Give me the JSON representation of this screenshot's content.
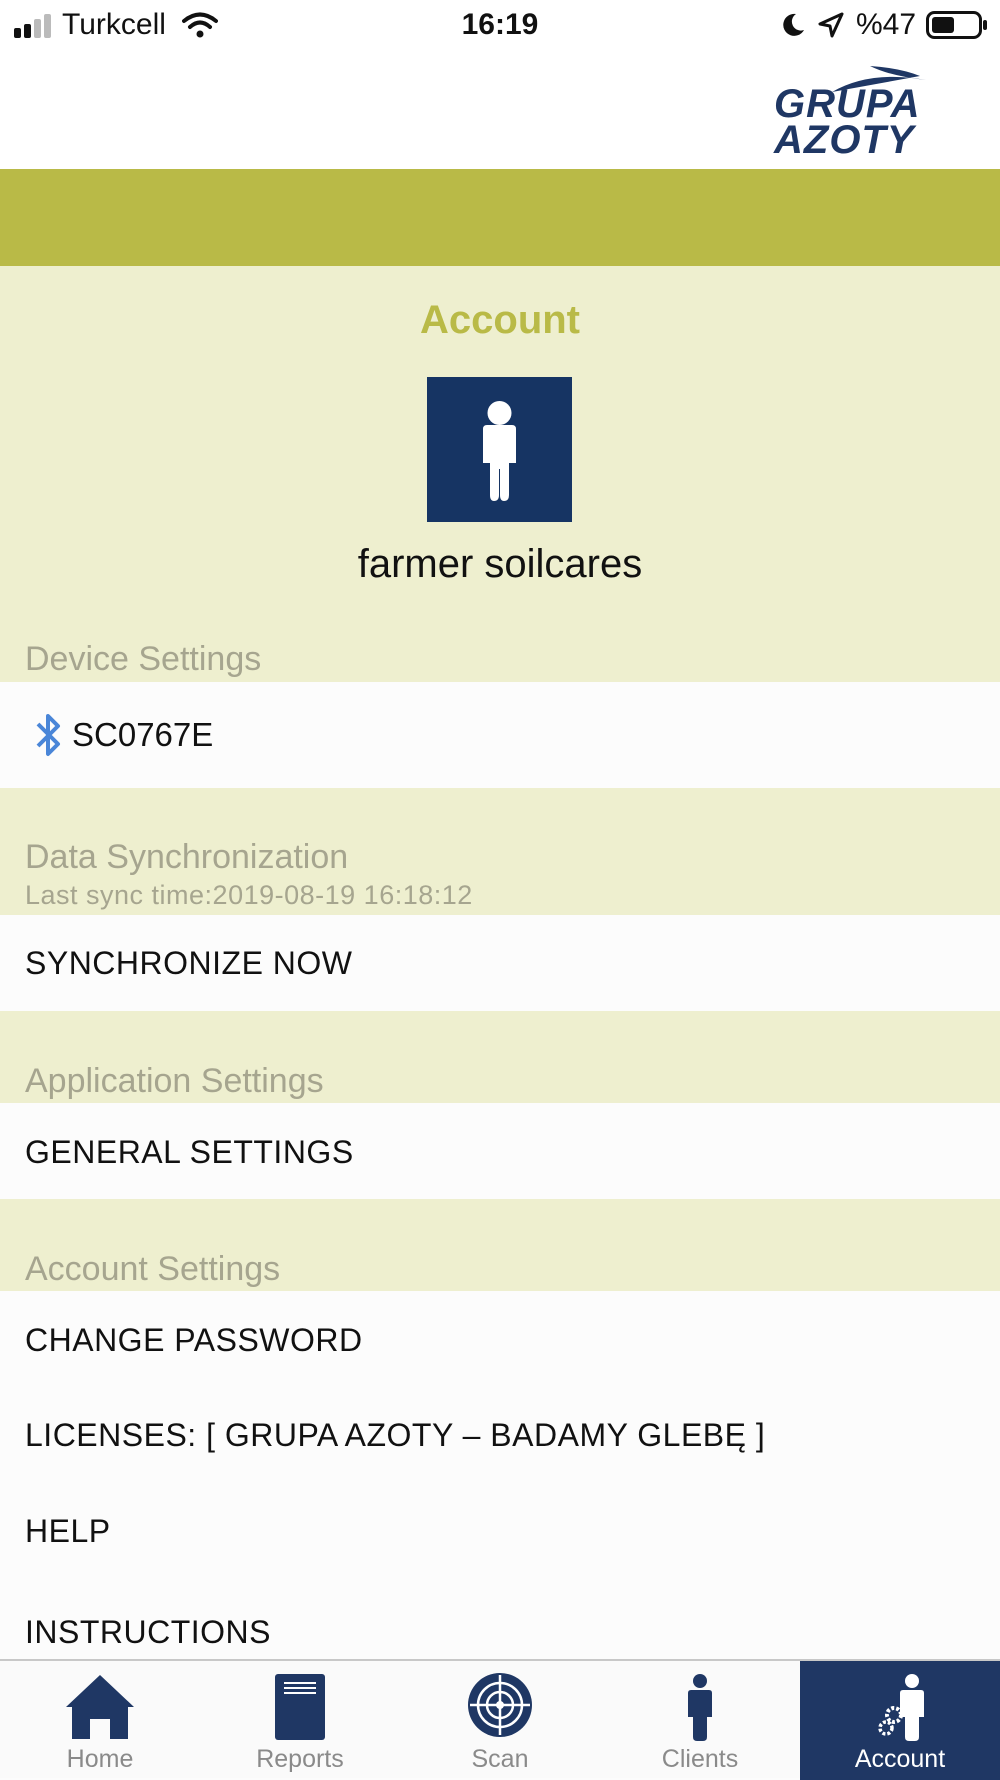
{
  "status_bar": {
    "carrier": "Turkcell",
    "time": "16:19",
    "battery": "%47"
  },
  "header": {
    "logo_line1": "GRUPA",
    "logo_line2": "AZOTY"
  },
  "account": {
    "title": "Account",
    "user_name": "farmer soilcares"
  },
  "device_settings": {
    "title": "Device Settings",
    "device_name": "SC0767E"
  },
  "data_sync": {
    "title": "Data Synchronization",
    "last_sync": "Last sync time:2019-08-19 16:18:12",
    "sync_now": "SYNCHRONIZE NOW"
  },
  "application_settings": {
    "title": "Application Settings",
    "general": "GENERAL SETTINGS"
  },
  "account_settings": {
    "title": "Account Settings",
    "change_password": "CHANGE PASSWORD",
    "licenses": "LICENSES: [ GRUPA AZOTY – BADAMY GLEBĘ ]",
    "help": "HELP",
    "instructions": "INSTRUCTIONS"
  },
  "nav": {
    "items": [
      {
        "label": "Home",
        "icon": "home-icon"
      },
      {
        "label": "Reports",
        "icon": "reports-icon"
      },
      {
        "label": "Scan",
        "icon": "scan-icon"
      },
      {
        "label": "Clients",
        "icon": "clients-icon"
      },
      {
        "label": "Account",
        "icon": "account-icon"
      }
    ],
    "active": "Account"
  },
  "colors": {
    "olive": "#b9ba47",
    "beige": "#eeefcf",
    "navy": "#1f3764",
    "bluetooth": "#4a86d8"
  }
}
